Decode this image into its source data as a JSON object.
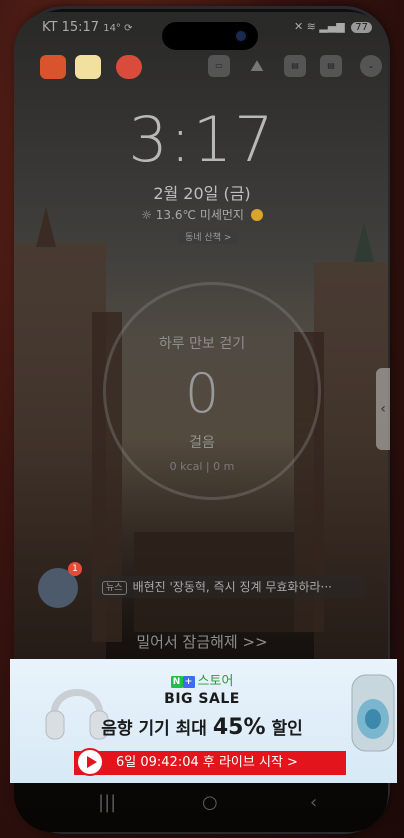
{
  "status_bar": {
    "carrier_time": "KT 15:17",
    "left_extra": "14° ⟳",
    "battery": "77"
  },
  "lockscreen": {
    "clock": "3:17",
    "date": "2월 20일 (금)",
    "temperature": "13.6℃",
    "air_quality_label": "미세먼지",
    "quick_button": "동네 산책 >"
  },
  "step_counter": {
    "title": "하루 만보 걷기",
    "steps": "0",
    "unit": "걸음",
    "kcal": "0 kcal",
    "distance": "0 m"
  },
  "notification": {
    "badge_count": "1",
    "tag": "뉴스",
    "text": "배현진 '장동혁, 즉시 징계 무효화하라···"
  },
  "unlock_hint": "밀어서 잠금해제 >>",
  "ad": {
    "store_label": "스토어",
    "store_n": "N",
    "store_plus": "+",
    "sale_title": "BIG SALE",
    "headline_prefix": "음향 기기 최대 ",
    "headline_pct": "45%",
    "headline_suffix": " 할인",
    "live_text": "6일 09:42:04 후 라이브 시작 >"
  },
  "icons": {
    "recent": "recent-apps-icon",
    "home": "home-icon",
    "back": "back-icon"
  },
  "colors": {
    "ad_red": "#e3141b",
    "store_green": "#1fbf4a",
    "ad_background": "#e9f3fb"
  }
}
